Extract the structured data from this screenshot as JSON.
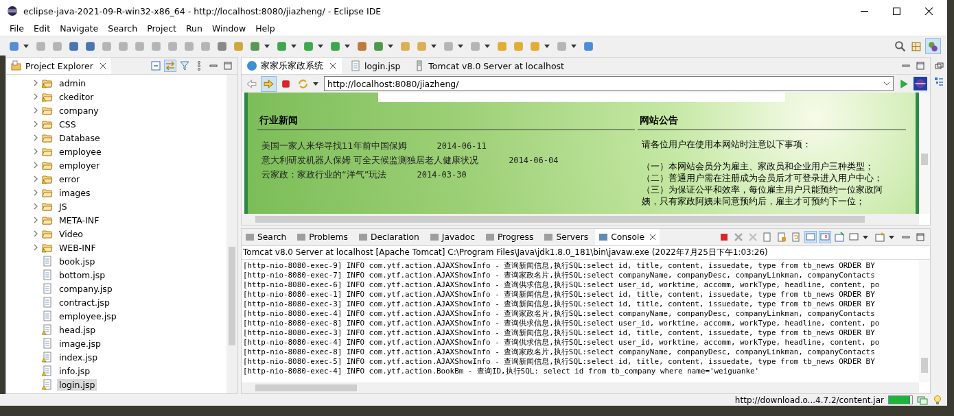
{
  "window": {
    "title": "eclipse-java-2021-09-R-win32-x86_64 - http://localhost:8080/jiazheng/ - Eclipse IDE"
  },
  "menu": [
    {
      "label": "File"
    },
    {
      "label": "Edit"
    },
    {
      "label": "Navigate"
    },
    {
      "label": "Search"
    },
    {
      "label": "Project"
    },
    {
      "label": "Run"
    },
    {
      "label": "Window"
    },
    {
      "label": "Help"
    }
  ],
  "project_explorer": {
    "title": "Project Explorer",
    "items": [
      {
        "label": "admin",
        "kind": "folder",
        "warning": true,
        "selected": false
      },
      {
        "label": "ckeditor",
        "kind": "folder",
        "warning": true,
        "selected": false
      },
      {
        "label": "company",
        "kind": "folder",
        "warning": false,
        "selected": false
      },
      {
        "label": "CSS",
        "kind": "folder",
        "warning": false,
        "selected": false
      },
      {
        "label": "Database",
        "kind": "folder",
        "warning": false,
        "selected": false
      },
      {
        "label": "employee",
        "kind": "folder",
        "warning": false,
        "selected": false
      },
      {
        "label": "employer",
        "kind": "folder",
        "warning": false,
        "selected": false
      },
      {
        "label": "error",
        "kind": "folder",
        "warning": true,
        "selected": false
      },
      {
        "label": "images",
        "kind": "folder",
        "warning": false,
        "selected": false
      },
      {
        "label": "JS",
        "kind": "folder",
        "warning": false,
        "selected": false
      },
      {
        "label": "META-INF",
        "kind": "folder",
        "warning": false,
        "selected": false
      },
      {
        "label": "Video",
        "kind": "folder",
        "warning": false,
        "selected": false
      },
      {
        "label": "WEB-INF",
        "kind": "folder",
        "warning": true,
        "selected": false
      },
      {
        "label": "book.jsp",
        "kind": "file",
        "warning": false,
        "selected": false
      },
      {
        "label": "bottom.jsp",
        "kind": "file",
        "warning": false,
        "selected": false
      },
      {
        "label": "company.jsp",
        "kind": "file",
        "warning": false,
        "selected": false
      },
      {
        "label": "contract.jsp",
        "kind": "file",
        "warning": false,
        "selected": false
      },
      {
        "label": "employee.jsp",
        "kind": "file",
        "warning": false,
        "selected": false
      },
      {
        "label": "head.jsp",
        "kind": "file",
        "warning": true,
        "selected": false
      },
      {
        "label": "image.jsp",
        "kind": "file",
        "warning": false,
        "selected": false
      },
      {
        "label": "index.jsp",
        "kind": "file",
        "warning": true,
        "selected": false
      },
      {
        "label": "info.jsp",
        "kind": "file",
        "warning": true,
        "selected": false
      },
      {
        "label": "login.jsp",
        "kind": "file",
        "warning": true,
        "selected": true
      }
    ]
  },
  "editor_tabs": [
    {
      "label": "家家乐家政系统",
      "kind": "browser",
      "selected": true
    },
    {
      "label": "login.jsp",
      "kind": "file",
      "selected": false
    },
    {
      "label": "Tomcat v8.0 Server at localhost",
      "kind": "server",
      "selected": false
    }
  ],
  "browser": {
    "url": "http://localhost:8080/jiazheng/"
  },
  "web_page": {
    "news_title": "行业新闻",
    "news": [
      {
        "title": "美国一家人来华寻找11年前中国保姆",
        "date": "2014-06-11"
      },
      {
        "title": "意大利研发机器人保姆 可全天候监测独居老人健康状况",
        "date": "2014-06-04"
      },
      {
        "title": "云家政：家政行业的“洋气”玩法",
        "date": "2014-03-30"
      }
    ],
    "notice_title": "网站公告",
    "notice_intro": "请各位用户在使用本网站时注意以下事项：",
    "notices": [
      "（一）本网站会员分为雇主、家政员和企业用户三种类型；",
      "（二）普通用户需在注册成为会员后才可登录进入用户中心；",
      "（三）为保证公平和效率，每位雇主用户只能预约一位家政阿",
      "姨，只有家政阿姨未同意预约后，雇主才可预约下一位；"
    ]
  },
  "console_tabs": [
    {
      "label": "Search",
      "selected": false
    },
    {
      "label": "Problems",
      "selected": false
    },
    {
      "label": "Declaration",
      "selected": false
    },
    {
      "label": "Javadoc",
      "selected": false
    },
    {
      "label": "Progress",
      "selected": false
    },
    {
      "label": "Servers",
      "selected": false
    },
    {
      "label": "Console",
      "selected": true
    }
  ],
  "console": {
    "header": "Tomcat v8.0 Server at localhost [Apache Tomcat] C:\\Program Files\\Java\\jdk1.8.0_181\\bin\\javaw.exe  (2022年7月25日下午1:03:26)",
    "lines": [
      "[http-nio-8080-exec-9] INFO com.ytf.action.AJAXShowInfo - 查询新闻信息,执行SQL:select id, title, content, issuedate, type from tb_news ORDER BY",
      "[http-nio-8080-exec-7] INFO com.ytf.action.AJAXShowInfo - 查询家政名片,执行SQL:select companyName, companyDesc, companyLinkman, companyContacts",
      "[http-nio-8080-exec-6] INFO com.ytf.action.AJAXShowInfo - 查询供求信息,执行SQL:select user_id, worktime, accomm, workType, headline, content, po",
      "[http-nio-8080-exec-1] INFO com.ytf.action.AJAXShowInfo - 查询新闻信息,执行SQL:select id, title, content, issuedate, type from tb_news ORDER BY",
      "[http-nio-8080-exec-3] INFO com.ytf.action.AJAXShowInfo - 查询新闻信息,执行SQL:select id, title, content, issuedate, type from tb_news ORDER BY",
      "[http-nio-8080-exec-4] INFO com.ytf.action.AJAXShowInfo - 查询家政名片,执行SQL:select companyName, companyDesc, companyLinkman, companyContacts",
      "[http-nio-8080-exec-8] INFO com.ytf.action.AJAXShowInfo - 查询供求信息,执行SQL:select user_id, worktime, accomm, workType, headline, content, po",
      "[http-nio-8080-exec-3] INFO com.ytf.action.AJAXShowInfo - 查询新闻信息,执行SQL:select id, title, content, issuedate, type from tb_news ORDER BY",
      "[http-nio-8080-exec-4] INFO com.ytf.action.AJAXShowInfo - 查询供求信息,执行SQL:select user_id, worktime, accomm, workType, headline, content, po",
      "[http-nio-8080-exec-8] INFO com.ytf.action.AJAXShowInfo - 查询家政名片,执行SQL:select companyName, companyDesc, companyLinkman, companyContacts",
      "[http-nio-8080-exec-5] INFO com.ytf.action.AJAXShowInfo - 查询新闻信息,执行SQL:select id, title, content, issuedate, type from tb_news ORDER BY",
      "[http-nio-8080-exec-4] INFO com.ytf.action.BookBm - 查询ID,执行SQL: select id from tb_company where name='weiguanke'"
    ]
  },
  "status_bar": {
    "text": "http://download.o...4.7.2/content.jar",
    "level": 0.9
  }
}
